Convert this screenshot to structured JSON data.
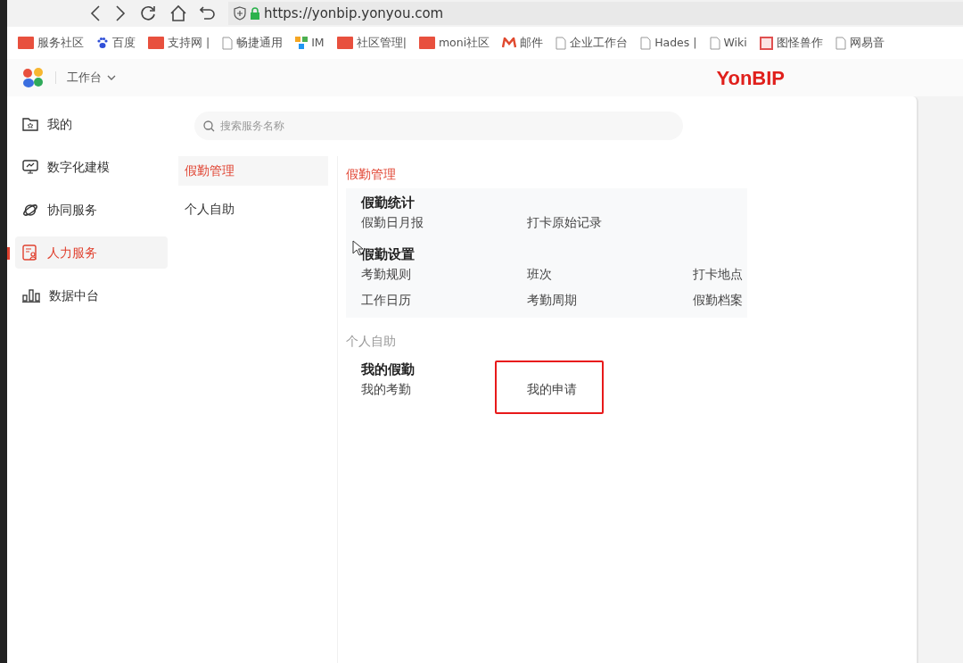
{
  "browser": {
    "url": "https://yonbip.yonyou.com"
  },
  "bookmarks": [
    {
      "label": "服务社区",
      "kind": "red"
    },
    {
      "label": "百度",
      "kind": "paw"
    },
    {
      "label": "支持网 |",
      "kind": "red"
    },
    {
      "label": "畅捷通用",
      "kind": "page"
    },
    {
      "label": "IM",
      "kind": "tiles"
    },
    {
      "label": "社区管理|",
      "kind": "red"
    },
    {
      "label": "moni社区",
      "kind": "red"
    },
    {
      "label": "邮件",
      "kind": "mail"
    },
    {
      "label": "企业工作台",
      "kind": "page"
    },
    {
      "label": "Hades |",
      "kind": "page"
    },
    {
      "label": "Wiki",
      "kind": "page"
    },
    {
      "label": "图怪兽作",
      "kind": "pic"
    },
    {
      "label": "网易音",
      "kind": "page"
    }
  ],
  "header": {
    "workspace": "工作台",
    "logo": "YonBIP"
  },
  "sidebar": {
    "items": [
      {
        "label": "我的",
        "kind": "folder",
        "selected": false
      },
      {
        "label": "数字化建模",
        "kind": "monitor",
        "selected": false
      },
      {
        "label": "协同服务",
        "kind": "orbit",
        "selected": false
      },
      {
        "label": "人力服务",
        "kind": "person",
        "selected": true
      },
      {
        "label": "数据中台",
        "kind": "bars",
        "selected": false
      }
    ]
  },
  "search": {
    "placeholder": "搜索服务名称"
  },
  "categories": [
    {
      "label": "假勤管理",
      "selected": true
    },
    {
      "label": "个人自助",
      "selected": false
    }
  ],
  "sections": [
    {
      "title": "假勤管理",
      "active": true,
      "groups": [
        {
          "title": "假勤统计",
          "items": [
            {
              "label": "假勤日月报",
              "outlined": false
            },
            {
              "label": "打卡原始记录",
              "outlined": false
            }
          ]
        },
        {
          "title": "假勤设置",
          "items": [
            {
              "label": "考勤规则",
              "outlined": false
            },
            {
              "label": "班次",
              "outlined": false
            },
            {
              "label": "打卡地点",
              "outlined": false
            },
            {
              "label": "工作日历",
              "outlined": false
            },
            {
              "label": "考勤周期",
              "outlined": false
            },
            {
              "label": "假勤档案",
              "outlined": false
            }
          ]
        }
      ]
    },
    {
      "title": "个人自助",
      "active": false,
      "groups": [
        {
          "title": "我的假勤",
          "items": [
            {
              "label": "我的考勤",
              "outlined": false
            },
            {
              "label": "我的申请",
              "outlined": true
            }
          ]
        }
      ]
    }
  ]
}
